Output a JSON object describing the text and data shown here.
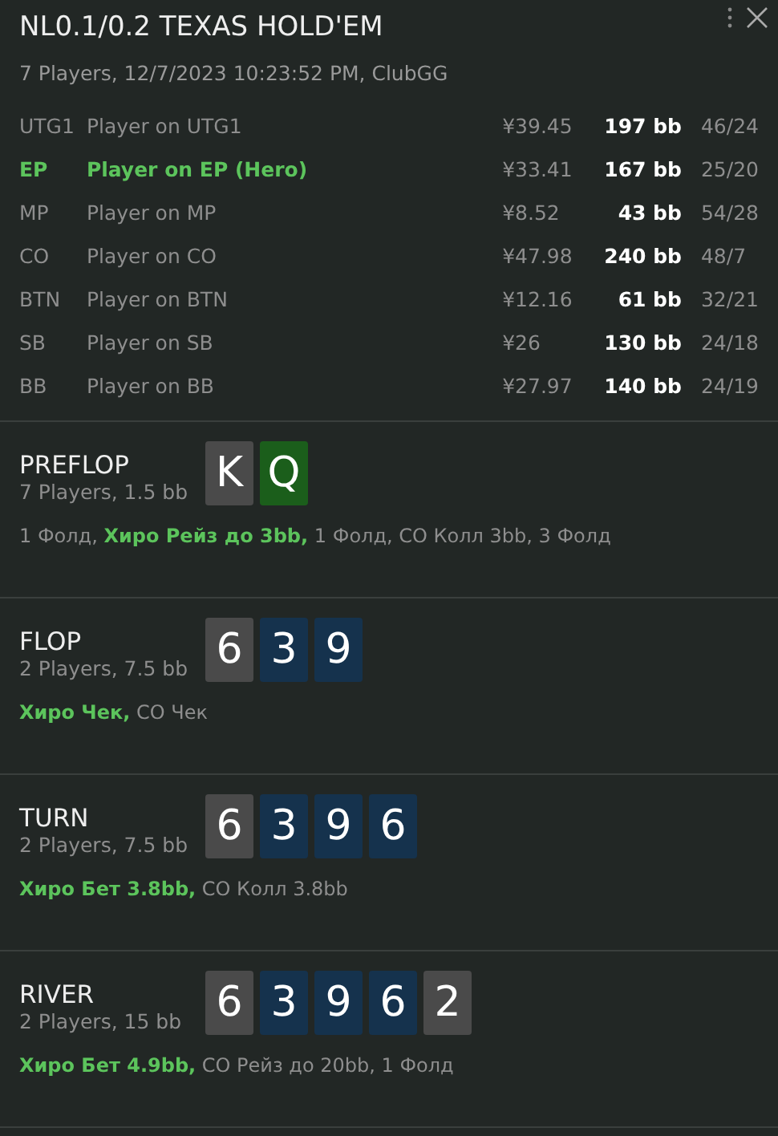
{
  "header": {
    "title": "NL0.1/0.2 TEXAS HOLD'EM",
    "subtitle": "7 Players, 12/7/2023 10:23:52 PM, ClubGG"
  },
  "players": [
    {
      "position": "UTG1",
      "name": "Player on UTG1",
      "stack": "¥39.45",
      "bb": "197 bb",
      "stats": "46/24",
      "hero": false
    },
    {
      "position": "EP",
      "name": "Player on EP (Hero)",
      "stack": "¥33.41",
      "bb": "167 bb",
      "stats": "25/20",
      "hero": true
    },
    {
      "position": "MP",
      "name": "Player on MP",
      "stack": "¥8.52",
      "bb": "43 bb",
      "stats": "54/28",
      "hero": false
    },
    {
      "position": "CO",
      "name": "Player on CO",
      "stack": "¥47.98",
      "bb": "240 bb",
      "stats": "48/7",
      "hero": false
    },
    {
      "position": "BTN",
      "name": "Player on BTN",
      "stack": "¥12.16",
      "bb": "61 bb",
      "stats": "32/21",
      "hero": false
    },
    {
      "position": "SB",
      "name": "Player on SB",
      "stack": "¥26",
      "bb": "130 bb",
      "stats": "24/18",
      "hero": false
    },
    {
      "position": "BB",
      "name": "Player on BB",
      "stack": "¥27.97",
      "bb": "140 bb",
      "stats": "24/19",
      "hero": false
    }
  ],
  "streets": [
    {
      "name": "PREFLOP",
      "info": "7 Players, 1.5 bb",
      "cards": [
        {
          "rank": "K",
          "color": "#4a4a4a"
        },
        {
          "rank": "Q",
          "color": "#1b5e1b"
        }
      ],
      "actions": "1 Фолд, **Хиро Рейз до 3bb,** 1 Фолд, CO Колл 3bb, 3 Фолд"
    },
    {
      "name": "FLOP",
      "info": "2 Players, 7.5 bb",
      "cards": [
        {
          "rank": "6",
          "color": "#4a4a4a"
        },
        {
          "rank": "3",
          "color": "#15324d"
        },
        {
          "rank": "9",
          "color": "#15324d"
        }
      ],
      "actions": "**Хиро Чек,** CO Чек"
    },
    {
      "name": "TURN",
      "info": "2 Players, 7.5 bb",
      "cards": [
        {
          "rank": "6",
          "color": "#4a4a4a"
        },
        {
          "rank": "3",
          "color": "#15324d"
        },
        {
          "rank": "9",
          "color": "#15324d"
        },
        {
          "rank": "6",
          "color": "#15324d"
        }
      ],
      "actions": "**Хиро Бет 3.8bb,** CO Колл 3.8bb"
    },
    {
      "name": "RIVER",
      "info": "2 Players, 15 bb",
      "cards": [
        {
          "rank": "6",
          "color": "#4a4a4a"
        },
        {
          "rank": "3",
          "color": "#15324d"
        },
        {
          "rank": "9",
          "color": "#15324d"
        },
        {
          "rank": "6",
          "color": "#15324d"
        },
        {
          "rank": "2",
          "color": "#4a4a4a"
        }
      ],
      "actions": "**Хиро Бет 4.9bb,** CO Рейз до 20bb, 1 Фолд"
    }
  ]
}
